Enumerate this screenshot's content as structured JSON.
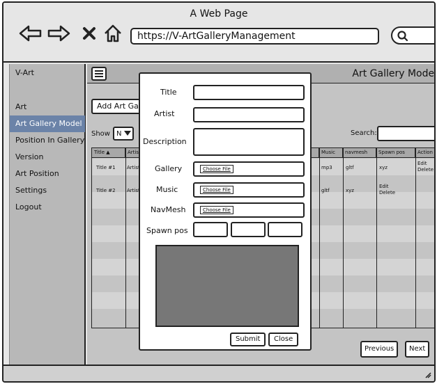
{
  "window": {
    "title": "A Web Page",
    "url": "https://V-ArtGalleryManagement"
  },
  "sidebar": {
    "brand": "V-Art",
    "items": [
      {
        "label": "Art",
        "active": false
      },
      {
        "label": "Art Gallery Model",
        "active": true
      },
      {
        "label": "Position In Gallery",
        "active": false
      },
      {
        "label": "Version",
        "active": false
      },
      {
        "label": "Art Position",
        "active": false
      },
      {
        "label": "Settings",
        "active": false
      },
      {
        "label": "Logout",
        "active": false
      }
    ]
  },
  "main": {
    "page_title": "Art Gallery Model",
    "add_button": "Add Art Galle",
    "show_label": "Show",
    "show_value": "N",
    "search_label": "Search:",
    "table": {
      "columns": [
        "Title ▲",
        "Artist",
        "Music",
        "navmesh",
        "Spawn pos",
        "Action"
      ],
      "rows": [
        {
          "title": "Title #1",
          "artist": "Artist",
          "music": "mp3",
          "navmesh": "gltf",
          "spawn": "xyz",
          "action_edit": "Edit",
          "action_delete": "Delete"
        },
        {
          "title": "Title #2",
          "artist": "Artist",
          "music": "gltf",
          "navmesh": "xyz",
          "spawn": "Edit",
          "action_edit": "",
          "action_delete": "Delete"
        }
      ]
    },
    "pagination": {
      "previous": "Previous",
      "next": "Next"
    }
  },
  "modal": {
    "fields": {
      "title": "Title",
      "artist": "Artist",
      "description": "Description",
      "gallery": "Gallery",
      "music": "Music",
      "navmesh": "NavMesh",
      "spawn_pos": "Spawn pos"
    },
    "choose_file": "Choose File",
    "submit": "Submit",
    "close": "Close"
  },
  "colors": {
    "accent": "#6b83a8",
    "sidebar_bg": "#b8b8b8",
    "preview_bg": "#777777"
  }
}
